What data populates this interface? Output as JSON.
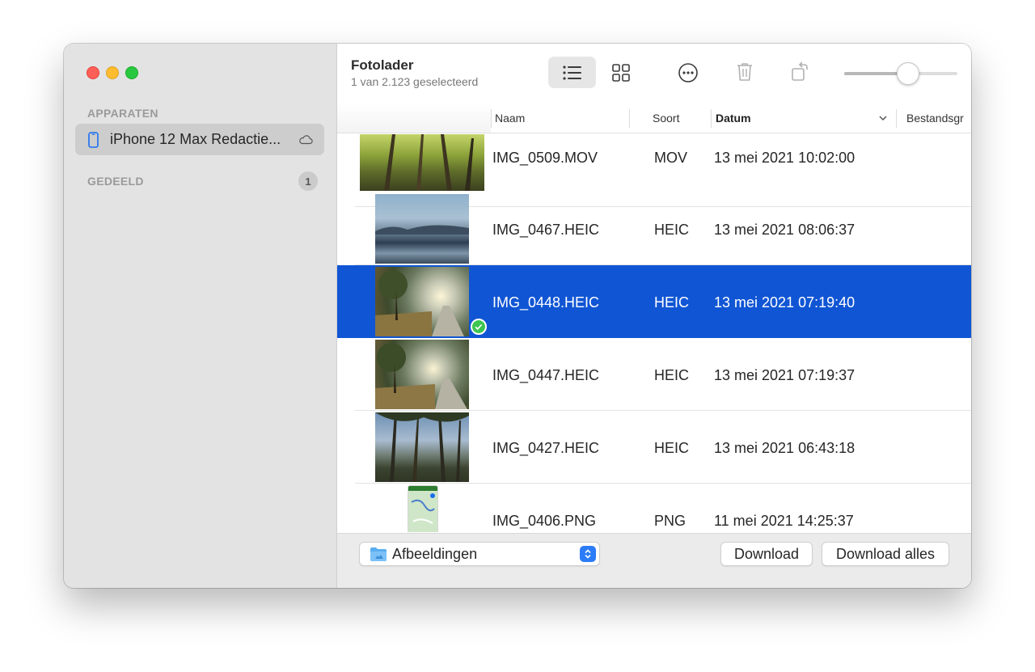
{
  "sidebar": {
    "section_devices": "APPARATEN",
    "device_label": "iPhone 12 Max Redactie...",
    "section_shared": "GEDEELD",
    "shared_count": "1"
  },
  "header": {
    "title": "Fotolader",
    "subtitle": "1 van 2.123 geselecteerd"
  },
  "toolbar": {
    "icons": [
      "list-view-icon",
      "grid-view-icon",
      "more-icon",
      "trash-icon",
      "rotate-icon"
    ],
    "thumbnail_size_fraction": 0.58
  },
  "table": {
    "columns": {
      "name": "Naam",
      "kind": "Soort",
      "date": "Datum",
      "size": "Bestandsgr"
    },
    "sort_column": "Datum",
    "rows": [
      {
        "name": "IMG_0509.MOV",
        "kind": "MOV",
        "date": "13 mei 2021 10:02:00",
        "selected": false
      },
      {
        "name": "IMG_0467.HEIC",
        "kind": "HEIC",
        "date": "13 mei 2021 08:06:37",
        "selected": false
      },
      {
        "name": "IMG_0448.HEIC",
        "kind": "HEIC",
        "date": "13 mei 2021 07:19:40",
        "selected": true
      },
      {
        "name": "IMG_0447.HEIC",
        "kind": "HEIC",
        "date": "13 mei 2021 07:19:37",
        "selected": false
      },
      {
        "name": "IMG_0427.HEIC",
        "kind": "HEIC",
        "date": "13 mei 2021 06:43:18",
        "selected": false
      },
      {
        "name": "IMG_0406.PNG",
        "kind": "PNG",
        "date": "11 mei 2021 14:25:37",
        "selected": false
      }
    ]
  },
  "footer": {
    "destination": "Afbeeldingen",
    "download_label": "Download",
    "download_all_label": "Download alles"
  },
  "colors": {
    "selection": "#1055d4",
    "sidebar_bg": "#e3e3e3",
    "accent": "#2b7cf6",
    "check": "#3cc651"
  }
}
